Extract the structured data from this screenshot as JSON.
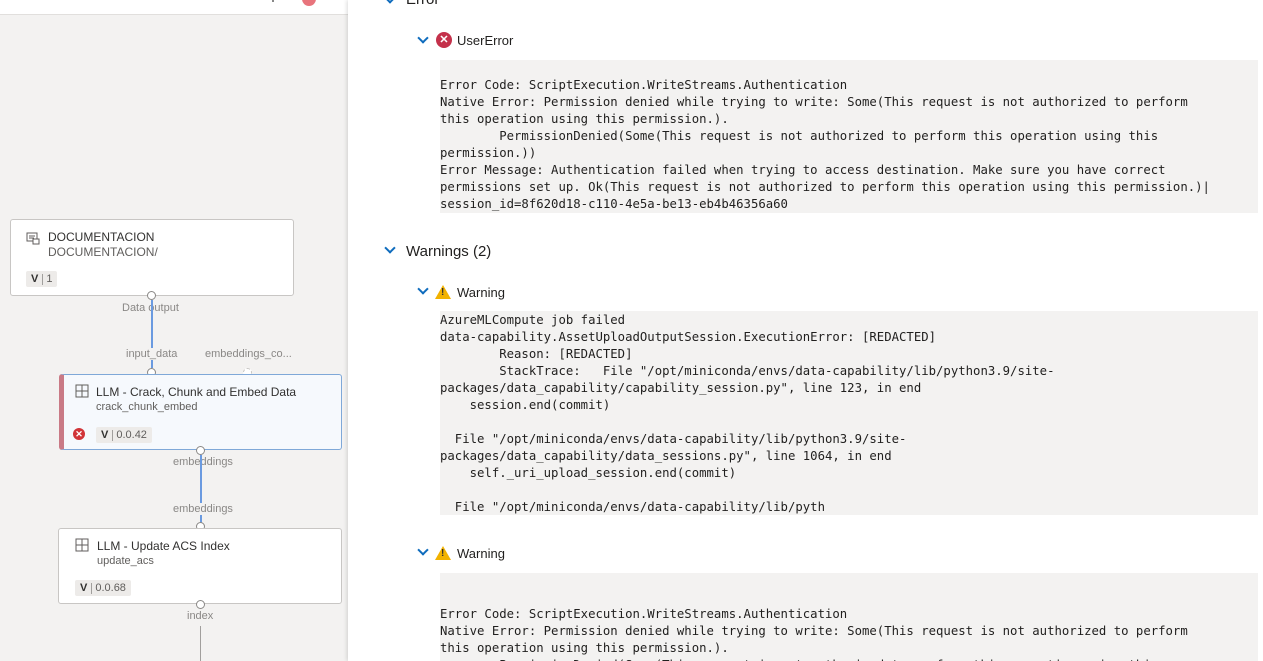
{
  "pipeline": {
    "nodes": [
      {
        "title": "DOCUMENTACION",
        "subtitle": "DOCUMENTACION/",
        "version_prefix": "V",
        "version": "1",
        "output_label": "Data output"
      },
      {
        "title": "LLM - Crack, Chunk and Embed Data",
        "subtitle": "crack_chunk_embed",
        "version_prefix": "V",
        "version": "0.0.42",
        "input_labels": [
          "input_data",
          "embeddings_co..."
        ],
        "output_label": "embeddings",
        "status": "failed"
      },
      {
        "title": "LLM - Update ACS Index",
        "subtitle": "update_acs",
        "version_prefix": "V",
        "version": "0.0.68",
        "input_label": "embeddings",
        "output_label": "index"
      }
    ]
  },
  "details": {
    "error_section": {
      "title": "Error",
      "item": {
        "title": "UserError",
        "lines": [
          "Error Code: ScriptExecution.WriteStreams.Authentication",
          "Native Error: Permission denied while trying to write: Some(This request is not authorized to perform",
          "this operation using this permission.).",
          "        PermissionDenied(Some(This request is not authorized to perform this operation using this",
          "permission.))",
          "Error Message: Authentication failed when trying to access destination. Make sure you have correct",
          "permissions set up. Ok(This request is not authorized to perform this operation using this permission.)|",
          "session_id=8f620d18-c110-4e5a-be13-eb4b46356a60"
        ]
      }
    },
    "warnings_section": {
      "title": "Warnings (2)",
      "items": [
        {
          "title": "Warning",
          "lines": [
            "AzureMLCompute job failed",
            "data-capability.AssetUploadOutputSession.ExecutionError: [REDACTED]",
            "        Reason: [REDACTED]",
            "        StackTrace:   File \"/opt/miniconda/envs/data-capability/lib/python3.9/site-",
            "packages/data_capability/capability_session.py\", line 123, in end",
            "    session.end(commit)",
            "",
            "  File \"/opt/miniconda/envs/data-capability/lib/python3.9/site-",
            "packages/data_capability/data_sessions.py\", line 1064, in end",
            "    self._uri_upload_session.end(commit)",
            "",
            "  File \"/opt/miniconda/envs/data-capability/lib/pyth"
          ]
        },
        {
          "title": "Warning",
          "lines": [
            "",
            "Error Code: ScriptExecution.WriteStreams.Authentication",
            "Native Error: Permission denied while trying to write: Some(This request is not authorized to perform",
            "this operation using this permission.).",
            "        PermissionDenied(Some(This request is not authorized to perform this operation using this"
          ]
        }
      ]
    }
  },
  "colors": {
    "accent": "#0f6cbd",
    "error": "#c4314b",
    "warning": "#f2b200",
    "edge": "#6a9ae0"
  },
  "icons": {
    "error": "error-circle-icon",
    "warning": "warning-triangle-icon",
    "collapse": "chevron-down-icon",
    "dataset": "dataset-icon",
    "component": "component-icon"
  }
}
